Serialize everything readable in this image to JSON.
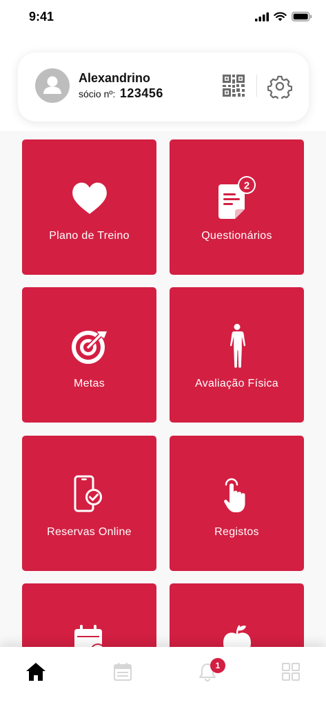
{
  "status_bar": {
    "time": "9:41",
    "icons": [
      "signal-icon",
      "wifi-icon",
      "battery-icon"
    ]
  },
  "profile": {
    "name": "Alexandrino",
    "member_label": "sócio nº:",
    "member_number": "123456",
    "icons": [
      "user-avatar-icon",
      "qr-code-icon",
      "gear-icon"
    ]
  },
  "menu": {
    "items": [
      {
        "label": "Plano de Treino",
        "icon": "heart-icon"
      },
      {
        "label": "Questionários",
        "icon": "document-icon",
        "badge": "2"
      },
      {
        "label": "Metas",
        "icon": "target-icon"
      },
      {
        "label": "Avaliação Física",
        "icon": "body-icon"
      },
      {
        "label": "Reservas Online",
        "icon": "phone-check-icon"
      },
      {
        "label": "Registos",
        "icon": "hand-pointer-icon"
      },
      {
        "label": "",
        "icon": "calendar-icon"
      },
      {
        "label": "",
        "icon": "apple-icon"
      }
    ]
  },
  "bottom_nav": {
    "items": [
      {
        "icon": "home-icon",
        "active": true
      },
      {
        "icon": "calendar-icon",
        "active": false
      },
      {
        "icon": "bell-icon",
        "active": false,
        "badge": "1"
      },
      {
        "icon": "grid-icon",
        "active": false
      }
    ]
  },
  "colors": {
    "accent": "#d31f42",
    "background": "#f8f8f8",
    "inactive_icon": "#d6d6d6"
  }
}
